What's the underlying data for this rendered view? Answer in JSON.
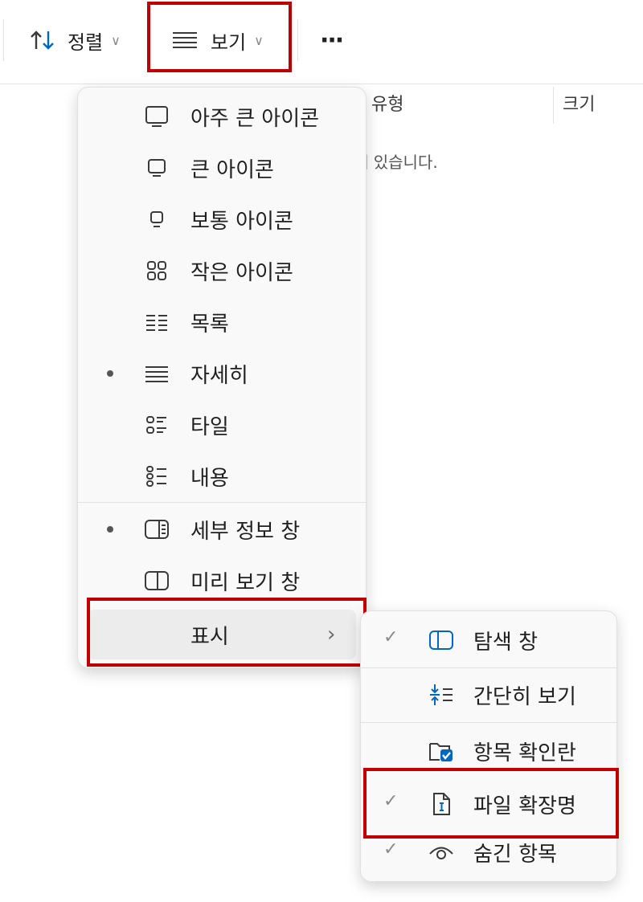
{
  "toolbar": {
    "sort_label": "정렬",
    "view_label": "보기",
    "more_label": "···"
  },
  "columns": {
    "type": "유형",
    "size": "크기",
    "empty_partial": "에 있습니다."
  },
  "view_menu": {
    "items": [
      {
        "label": "아주 큰 아이콘",
        "icon": "extra-large-icons-icon",
        "selected": false
      },
      {
        "label": "큰 아이콘",
        "icon": "large-icons-icon",
        "selected": false
      },
      {
        "label": "보통 아이콘",
        "icon": "medium-icons-icon",
        "selected": false
      },
      {
        "label": "작은 아이콘",
        "icon": "small-icons-icon",
        "selected": false
      },
      {
        "label": "목록",
        "icon": "list-icon",
        "selected": false
      },
      {
        "label": "자세히",
        "icon": "details-icon",
        "selected": true
      },
      {
        "label": "타일",
        "icon": "tiles-icon",
        "selected": false
      },
      {
        "label": "내용",
        "icon": "content-icon",
        "selected": false
      }
    ],
    "panes": [
      {
        "label": "세부 정보 창",
        "icon": "details-pane-icon",
        "selected": true
      },
      {
        "label": "미리 보기 창",
        "icon": "preview-pane-icon",
        "selected": false
      }
    ],
    "show_label": "표시",
    "show_chevron": "›"
  },
  "show_submenu": {
    "items": [
      {
        "label": "탐색 창",
        "icon": "navigation-pane-icon",
        "checked": true
      },
      {
        "label": "간단히 보기",
        "icon": "compact-view-icon",
        "checked": false
      },
      {
        "label": "항목 확인란",
        "icon": "item-checkbox-icon",
        "checked": false
      },
      {
        "label": "파일 확장명",
        "icon": "file-extension-icon",
        "checked": true
      },
      {
        "label": "숨긴 항목",
        "icon": "hidden-items-icon",
        "checked": true
      }
    ],
    "check_glyph": "✓"
  },
  "colors": {
    "highlight": "#c00000",
    "accent_blue": "#0067c0",
    "menu_bg": "#f9f9f9"
  }
}
